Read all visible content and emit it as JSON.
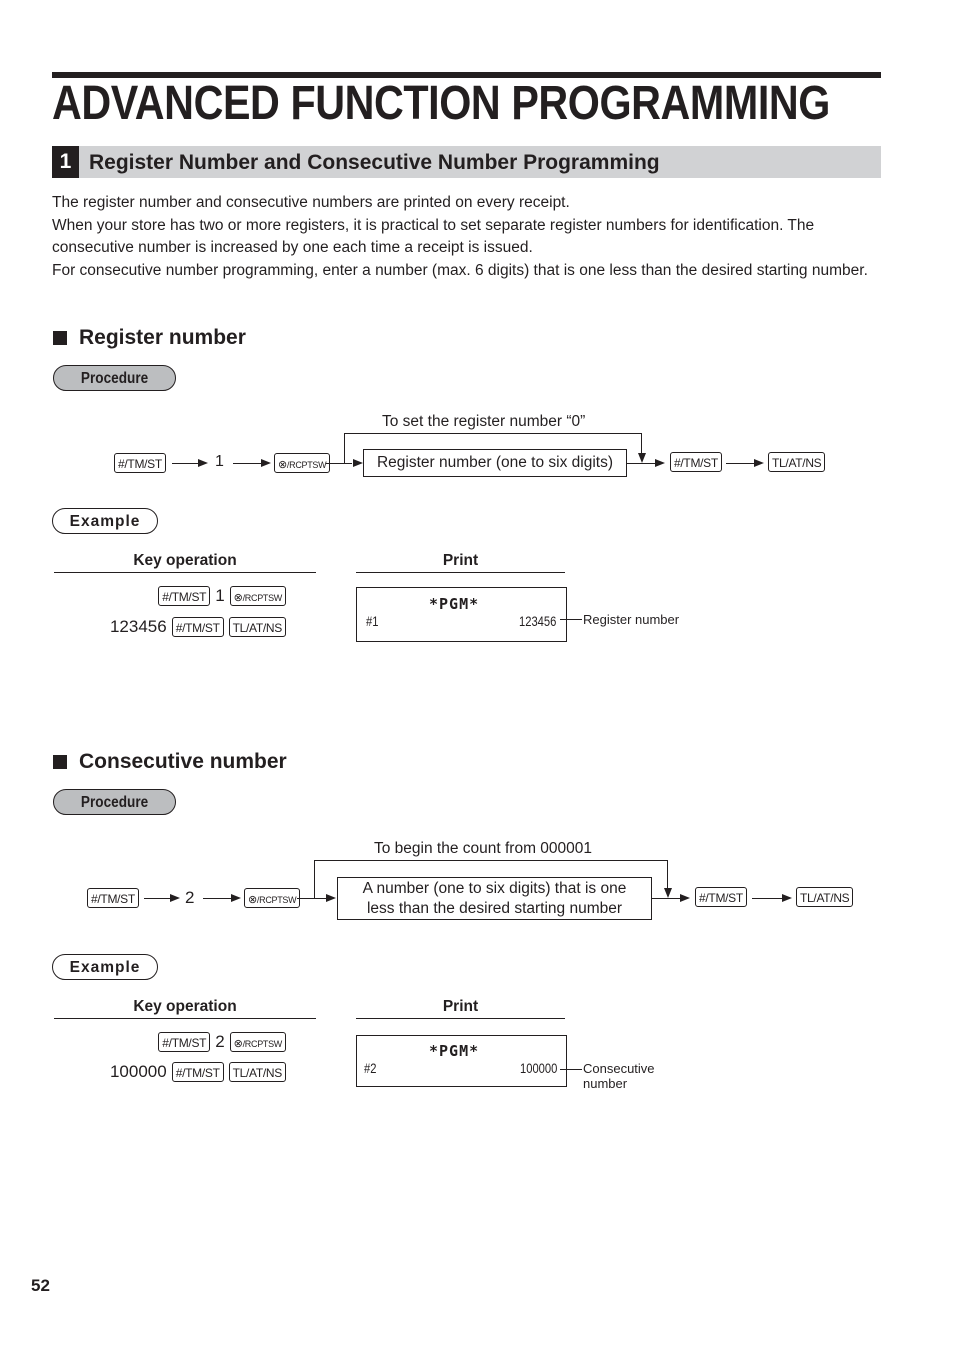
{
  "page": {
    "title": "ADVANCED FUNCTION PROGRAMMING",
    "page_number": "52"
  },
  "section": {
    "number": "1",
    "title": "Register Number and Consecutive Number Programming",
    "intro": [
      "The register number and consecutive numbers are printed on every receipt.",
      "When your store has two or more registers, it is practical to set separate register numbers for identification. The consecutive number is increased by one each time a receipt is issued.",
      "For consecutive number programming, enter a number (max. 6 digits) that is one less than the desired starting number."
    ]
  },
  "keys": {
    "tm_st": "#/TM/ST",
    "rcptsw_symbol": "⊗",
    "rcptsw": "/RCPTSW",
    "tl_at_ns": "TL/AT/NS"
  },
  "register_number": {
    "heading": "Register number",
    "procedure_label": "Procedure",
    "step_number": "1",
    "bypass_note": "To set the register number “0”",
    "input_box": "Register number (one to six digits)",
    "example_label": "Example",
    "key_operation_header": "Key operation",
    "print_header": "Print",
    "key_rows": [
      {
        "prefix": "",
        "digit": "1"
      },
      {
        "prefix": "123456"
      }
    ],
    "receipt": {
      "header": "*PGM*",
      "left": "#1",
      "right": "123456"
    },
    "callout": "Register number"
  },
  "consecutive_number": {
    "heading": "Consecutive number",
    "procedure_label": "Procedure",
    "step_number": "2",
    "bypass_note": "To begin the count from 000001",
    "input_box_line1": "A number (one to six digits) that is one",
    "input_box_line2": "less than the desired starting number",
    "example_label": "Example",
    "key_operation_header": "Key operation",
    "print_header": "Print",
    "key_rows": [
      {
        "prefix": "",
        "digit": "2"
      },
      {
        "prefix": "100000"
      }
    ],
    "receipt": {
      "header": "*PGM*",
      "left": "#2",
      "right": "100000"
    },
    "callout_line1": "Consecutive",
    "callout_line2": "number"
  }
}
